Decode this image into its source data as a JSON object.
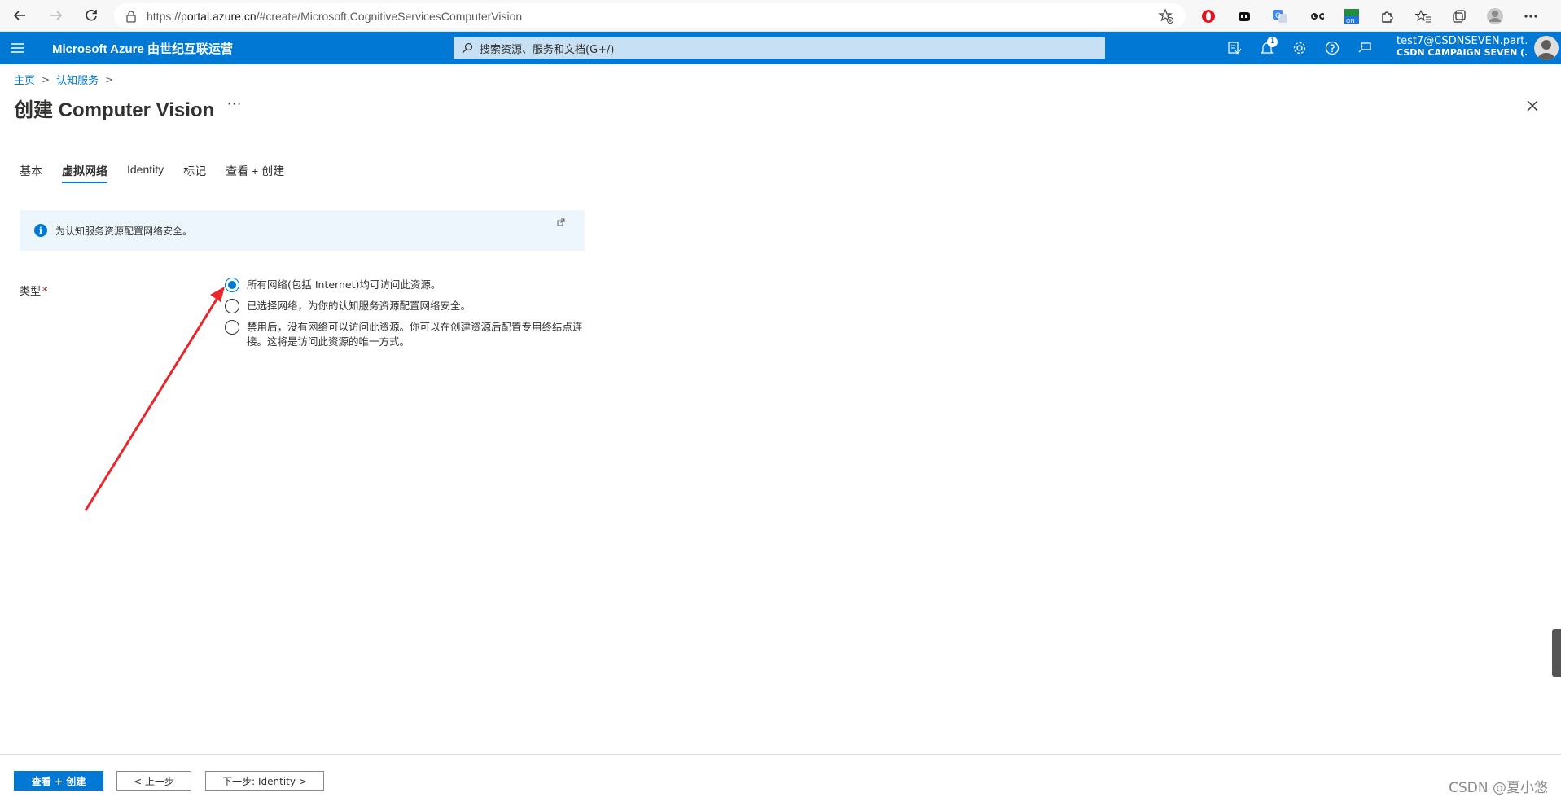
{
  "browser": {
    "url_prefix": "https://",
    "url_domain": "portal.azure.cn",
    "url_path": "/#create/Microsoft.CognitiveServicesComputerVision",
    "ext_on_badge": "ON"
  },
  "header": {
    "brand": "Microsoft Azure 由世纪互联运营",
    "search_placeholder": "搜索资源、服务和文档(G+/)",
    "notification_count": "1",
    "user": "test7@CSDNSEVEN.part...",
    "directory": "CSDN CAMPAIGN SEVEN (..."
  },
  "breadcrumb": {
    "home": "主页",
    "cognitive": "认知服务",
    "sep": ">"
  },
  "page": {
    "title": "创建 Computer Vision",
    "more": "···"
  },
  "tabs": [
    {
      "label": "基本"
    },
    {
      "label": "虚拟网络"
    },
    {
      "label": "Identity"
    },
    {
      "label": "标记"
    },
    {
      "label": "查看 + 创建"
    }
  ],
  "active_tab": "虚拟网络",
  "info": {
    "text": "为认知服务资源配置网络安全。"
  },
  "form": {
    "type_label": "类型",
    "required_mark": "*",
    "options": [
      {
        "label": "所有网络(包括 Internet)均可访问此资源。",
        "checked": true
      },
      {
        "label": "已选择网络，为你的认知服务资源配置网络安全。",
        "checked": false
      },
      {
        "label": "禁用后，没有网络可以访问此资源。你可以在创建资源后配置专用终结点连接。这将是访问此资源的唯一方式。",
        "checked": false
      }
    ]
  },
  "footer": {
    "review_create": "查看 + 创建",
    "previous": "< 上一步",
    "next": "下一步: Identity >"
  },
  "watermark": "CSDN @夏小悠",
  "colors": {
    "azure_blue": "#0078d4",
    "arrow_red": "#e8262b",
    "info_bg": "#eef6fd"
  }
}
